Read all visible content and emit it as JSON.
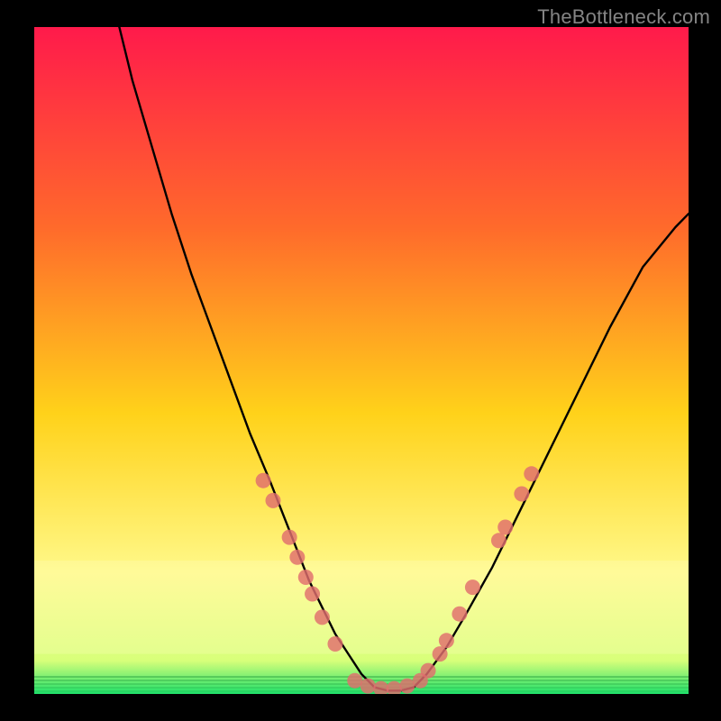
{
  "watermark": "TheBottleneck.com",
  "colors": {
    "background": "#000000",
    "gradient_top": "#ff1a4b",
    "gradient_mid_upper": "#ff6a2b",
    "gradient_mid": "#ffd21a",
    "gradient_lower": "#fff98a",
    "gradient_bottom": "#20e06a",
    "curve_stroke": "#000000",
    "marker_fill": "#e06e6e",
    "marker_stroke": "#c95a5a"
  },
  "chart_data": {
    "type": "line",
    "title": "",
    "xlabel": "",
    "ylabel": "",
    "xlim": [
      0,
      100
    ],
    "ylim": [
      0,
      100
    ],
    "grid": false,
    "legend": false,
    "curve": {
      "name": "bottleneck-curve",
      "x": [
        13,
        15,
        18,
        21,
        24,
        27,
        30,
        33,
        36,
        38,
        40,
        42,
        44,
        46,
        48,
        50,
        52,
        54,
        56,
        58,
        60,
        63,
        66,
        70,
        74,
        78,
        83,
        88,
        93,
        98,
        100
      ],
      "y": [
        100,
        92,
        82,
        72,
        63,
        55,
        47,
        39,
        32,
        27,
        22,
        17,
        13,
        9,
        6,
        3,
        1,
        0.5,
        0.5,
        1,
        3,
        7,
        12,
        19,
        27,
        35,
        45,
        55,
        64,
        70,
        72
      ]
    },
    "markers": {
      "name": "sample-points",
      "points": [
        {
          "x": 35.0,
          "y": 32.0
        },
        {
          "x": 36.5,
          "y": 29.0
        },
        {
          "x": 39.0,
          "y": 23.5
        },
        {
          "x": 40.2,
          "y": 20.5
        },
        {
          "x": 41.5,
          "y": 17.5
        },
        {
          "x": 42.5,
          "y": 15.0
        },
        {
          "x": 44.0,
          "y": 11.5
        },
        {
          "x": 46.0,
          "y": 7.5
        },
        {
          "x": 49.0,
          "y": 2.0
        },
        {
          "x": 51.0,
          "y": 1.2
        },
        {
          "x": 53.0,
          "y": 0.8
        },
        {
          "x": 55.0,
          "y": 0.8
        },
        {
          "x": 57.0,
          "y": 1.2
        },
        {
          "x": 59.0,
          "y": 2.0
        },
        {
          "x": 60.2,
          "y": 3.5
        },
        {
          "x": 62.0,
          "y": 6.0
        },
        {
          "x": 63.0,
          "y": 8.0
        },
        {
          "x": 65.0,
          "y": 12.0
        },
        {
          "x": 67.0,
          "y": 16.0
        },
        {
          "x": 71.0,
          "y": 23.0
        },
        {
          "x": 72.0,
          "y": 25.0
        },
        {
          "x": 74.5,
          "y": 30.0
        },
        {
          "x": 76.0,
          "y": 33.0
        }
      ]
    }
  }
}
